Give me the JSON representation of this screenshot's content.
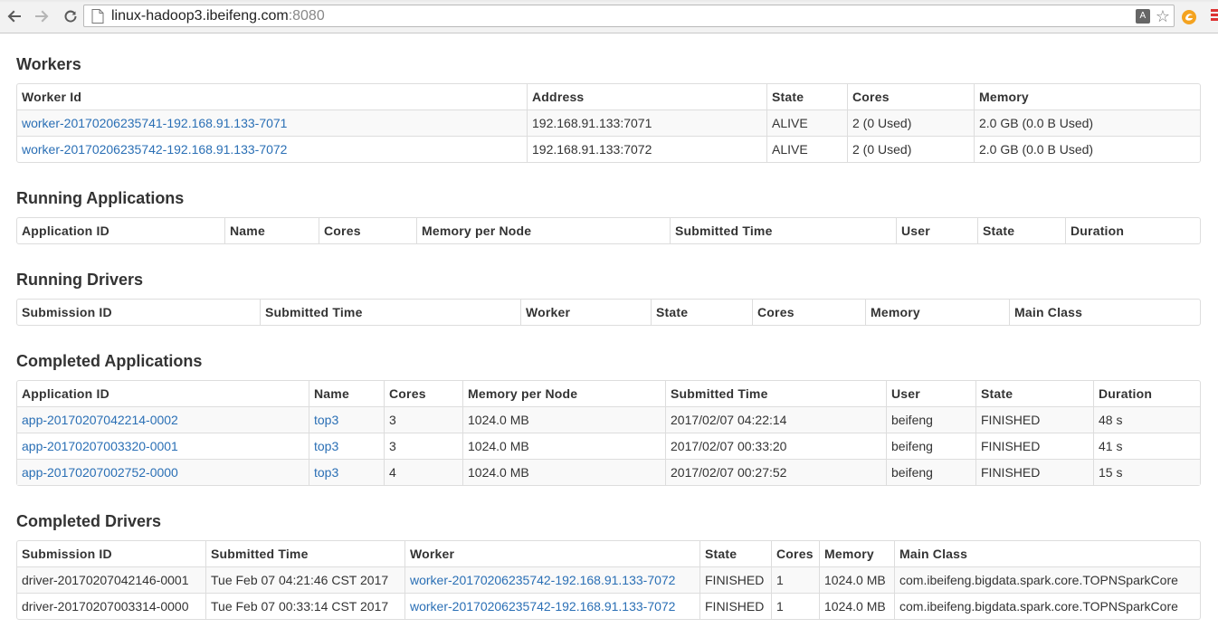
{
  "browser": {
    "url_host": "linux-hadoop3.ibeifeng.com",
    "url_port": ":8080"
  },
  "workers": {
    "title": "Workers",
    "columns": [
      "Worker Id",
      "Address",
      "State",
      "Cores",
      "Memory"
    ],
    "rows": [
      [
        "worker-20170206235741-192.168.91.133-7071",
        "192.168.91.133:7071",
        "ALIVE",
        "2 (0 Used)",
        "2.0 GB (0.0 B Used)"
      ],
      [
        "worker-20170206235742-192.168.91.133-7072",
        "192.168.91.133:7072",
        "ALIVE",
        "2 (0 Used)",
        "2.0 GB (0.0 B Used)"
      ]
    ]
  },
  "running_apps": {
    "title": "Running Applications",
    "columns": [
      "Application ID",
      "Name",
      "Cores",
      "Memory per Node",
      "Submitted Time",
      "User",
      "State",
      "Duration"
    ]
  },
  "running_drivers": {
    "title": "Running Drivers",
    "columns": [
      "Submission ID",
      "Submitted Time",
      "Worker",
      "State",
      "Cores",
      "Memory",
      "Main Class"
    ]
  },
  "completed_apps": {
    "title": "Completed Applications",
    "columns": [
      "Application ID",
      "Name",
      "Cores",
      "Memory per Node",
      "Submitted Time",
      "User",
      "State",
      "Duration"
    ],
    "rows": [
      [
        "app-20170207042214-0002",
        "top3",
        "3",
        "1024.0 MB",
        "2017/02/07 04:22:14",
        "beifeng",
        "FINISHED",
        "48 s"
      ],
      [
        "app-20170207003320-0001",
        "top3",
        "3",
        "1024.0 MB",
        "2017/02/07 00:33:20",
        "beifeng",
        "FINISHED",
        "41 s"
      ],
      [
        "app-20170207002752-0000",
        "top3",
        "4",
        "1024.0 MB",
        "2017/02/07 00:27:52",
        "beifeng",
        "FINISHED",
        "15 s"
      ]
    ]
  },
  "completed_drivers": {
    "title": "Completed Drivers",
    "columns": [
      "Submission ID",
      "Submitted Time",
      "Worker",
      "State",
      "Cores",
      "Memory",
      "Main Class"
    ],
    "rows": [
      [
        "driver-20170207042146-0001",
        "Tue Feb 07 04:21:46 CST 2017",
        "worker-20170206235742-192.168.91.133-7072",
        "FINISHED",
        "1",
        "1024.0 MB",
        "com.ibeifeng.bigdata.spark.core.TOPNSparkCore"
      ],
      [
        "driver-20170207003314-0000",
        "Tue Feb 07 00:33:14 CST 2017",
        "worker-20170206235742-192.168.91.133-7072",
        "FINISHED",
        "1",
        "1024.0 MB",
        "com.ibeifeng.bigdata.spark.core.TOPNSparkCore"
      ]
    ]
  },
  "colors": {
    "link": "#2a6fb5",
    "border": "#dddddd",
    "stripe": "#f9f9f9"
  }
}
